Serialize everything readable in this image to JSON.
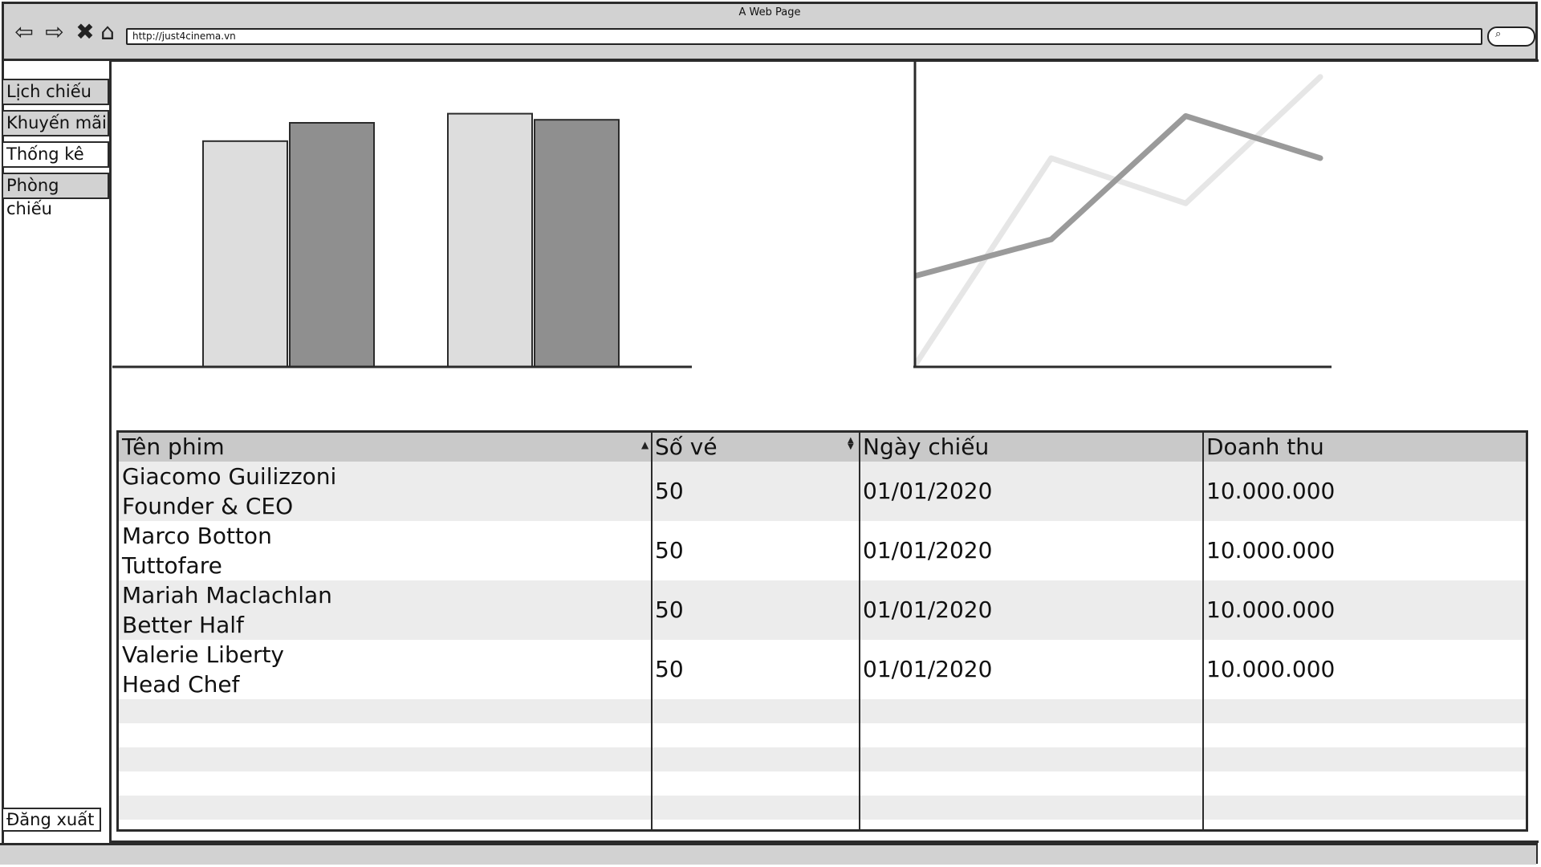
{
  "browser": {
    "title": "A Web Page",
    "url": "http://just4cinema.vn",
    "search_icon_text": "⌕"
  },
  "sidebar": {
    "items": [
      {
        "label": "Lịch chiếu",
        "active": false
      },
      {
        "label": "Khuyến mãi",
        "active": false
      },
      {
        "label": "Thống kê",
        "active": true
      },
      {
        "label": "Phòng chiếu",
        "active": false
      }
    ],
    "logout_label": "Đăng xuất"
  },
  "charts": {
    "bar_colors": [
      "#dddddd",
      "#8f8f8f"
    ],
    "line_colors": [
      "#e6e6e6",
      "#9a9a9a"
    ]
  },
  "chart_data": [
    {
      "type": "bar",
      "categories": [
        "",
        ""
      ],
      "series": [
        {
          "values": [
            74,
            83
          ]
        },
        {
          "values": [
            80,
            81
          ]
        }
      ],
      "ylim": [
        0,
        100
      ],
      "grid": false
    },
    {
      "type": "line",
      "x": [
        0,
        1,
        2,
        3
      ],
      "series": [
        {
          "values": [
            0,
            68,
            53,
            95
          ]
        },
        {
          "values": [
            29,
            41,
            82,
            68
          ]
        }
      ],
      "ylim": [
        0,
        100
      ],
      "grid": false
    }
  ],
  "table": {
    "columns": [
      "Tên phim",
      "Số vé",
      "Ngày chiếu",
      "Doanh thu"
    ],
    "rows": [
      {
        "name": "Giacomo Guilizzoni",
        "role": "Founder & CEO",
        "tickets": "50",
        "date": "01/01/2020",
        "revenue": "10.000.000"
      },
      {
        "name": "Marco Botton",
        "role": "Tuttofare",
        "tickets": "50",
        "date": "01/01/2020",
        "revenue": "10.000.000"
      },
      {
        "name": "Mariah Maclachlan",
        "role": "Better Half",
        "tickets": "50",
        "date": "01/01/2020",
        "revenue": "10.000.000"
      },
      {
        "name": "Valerie Liberty",
        "role": "Head Chef",
        "tickets": "50",
        "date": "01/01/2020",
        "revenue": "10.000.000"
      }
    ],
    "row_colors": [
      "#ececec",
      "#ffffff"
    ]
  }
}
